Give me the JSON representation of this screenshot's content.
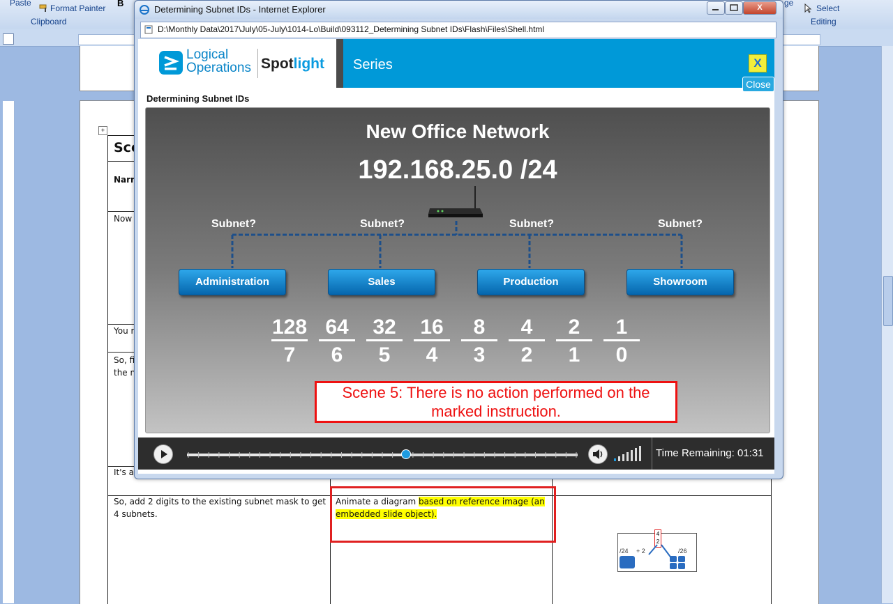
{
  "word": {
    "ribbon": {
      "paste_label": "Paste",
      "format_painter_label": "Format Painter",
      "clipboard_group": "Clipboard",
      "bold_label": "B",
      "select_label": "Select",
      "editing_group": "Editing",
      "partial_ge": "ge"
    },
    "table": {
      "header_cell": "Sce",
      "narration_label": "Narra",
      "row_now": "Now",
      "row_you": "You r",
      "row_so1": "So, fi",
      "row_so1b": "the n",
      "row_its": "It's a",
      "row_last_col1_line1": "So, add 2 digits to the existing subnet mask to get",
      "row_last_col1_line2": "4 subnets.",
      "row_last_col2_a": "Animate a diagram ",
      "row_last_col2_hl1": "based on reference image (an",
      "row_last_col2_hl2": "embedded slide object).",
      "thumb_left": "/24",
      "thumb_mid": "+ 2",
      "thumb_right": "/26",
      "thumb_top": "4",
      "thumb_top2": "2"
    }
  },
  "ie": {
    "title": "Determining Subnet IDs - Internet Explorer",
    "address": "D:\\Monthly Data\\2017\\July\\05-July\\1014-Lo\\Build\\093112_Determining Subnet IDs\\Flash\\Files\\Shell.html",
    "close_glyph": "X"
  },
  "player": {
    "brand_line1": "Logical",
    "brand_line2": "Operations",
    "brand_spot": "Spot",
    "brand_light": "light",
    "series": "Series",
    "x_button": "X",
    "close_button": "Close",
    "subtitle": "Determining Subnet IDs",
    "time_remaining": "Time Remaining: 01:31",
    "progress": 0.56
  },
  "slide": {
    "title": "New Office Network",
    "ip": "192.168.25.0 /24",
    "subnet_label": "Subnet?",
    "departments": [
      "Administration",
      "Sales",
      "Production",
      "Showroom"
    ],
    "bits_values": [
      "128",
      "64",
      "32",
      "16",
      "8",
      "4",
      "2",
      "1"
    ],
    "bits_positions": [
      "7",
      "6",
      "5",
      "4",
      "3",
      "2",
      "1",
      "0"
    ],
    "scene_note_line1": "Scene 5: There is no action performed on the",
    "scene_note_line2": "marked instruction."
  },
  "colors": {
    "header_blue": "#0099d8",
    "button_blue": "#0a78c8",
    "note_red": "#e11111",
    "highlight": "#ffff00"
  }
}
